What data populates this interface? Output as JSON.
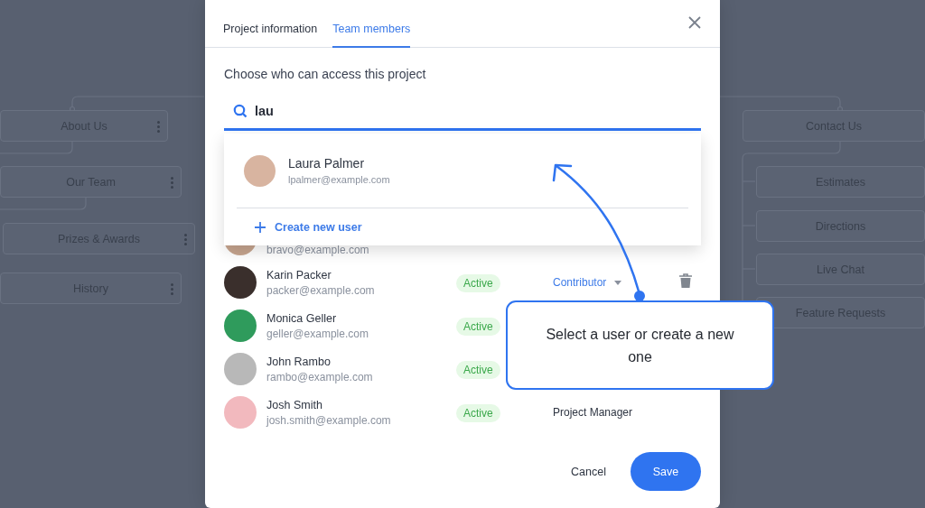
{
  "sitemap": {
    "left_nodes": [
      {
        "label": "About Us"
      },
      {
        "label": "Our Team"
      },
      {
        "label": "Prizes & Awards"
      },
      {
        "label": "History"
      }
    ],
    "right_nodes": [
      {
        "label": "Contact Us"
      },
      {
        "label": "Estimates"
      },
      {
        "label": "Directions"
      },
      {
        "label": "Live Chat"
      },
      {
        "label": "Feature Requests"
      }
    ]
  },
  "dialog": {
    "tabs": [
      {
        "label": "Project information",
        "selected": false
      },
      {
        "label": "Team members",
        "selected": true
      }
    ],
    "prompt": "Choose who can access this project",
    "search": {
      "value": "lau"
    },
    "suggestions": [
      {
        "name": "Laura Palmer",
        "email": "lpalmer@example.com"
      }
    ],
    "create_label": "Create new user",
    "members": [
      {
        "email": "bravo@example.com"
      },
      {
        "name": "Karin Packer",
        "email": "packer@example.com",
        "status": "Active",
        "role": {
          "kind": "dropdown",
          "label": "Contributor"
        },
        "removable": true
      },
      {
        "name": "Monica Geller",
        "email": "geller@example.com",
        "status": "Active",
        "removable": false
      },
      {
        "name": "John Rambo",
        "email": "rambo@example.com",
        "status": "Active",
        "removable": false
      },
      {
        "name": "Josh Smith",
        "email": "josh.smith@example.com",
        "status": "Active",
        "role": {
          "kind": "text",
          "label": "Project Manager"
        },
        "removable": false
      }
    ],
    "buttons": {
      "cancel": "Cancel",
      "save": "Save"
    }
  },
  "callout": {
    "text": "Select a user or create a new one"
  }
}
